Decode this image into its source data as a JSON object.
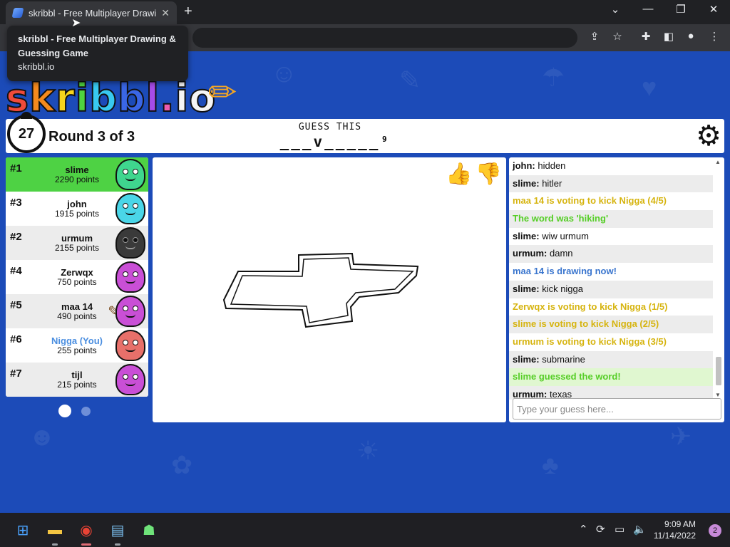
{
  "browser": {
    "tab_title": "skribbl - Free Multiplayer Drawing",
    "tab_close": "✕",
    "new_tab": "+",
    "tooltip_title": "skribbl - Free Multiplayer Drawing & Guessing Game",
    "tooltip_url": "skribbl.io"
  },
  "game": {
    "logo": "skribbl.io",
    "timer": "27",
    "round": "Round 3 of 3",
    "guess_label": "GUESS THIS",
    "word_pattern": "___v_____",
    "word_length": "9"
  },
  "players": [
    {
      "rank": "#1",
      "name": "slime",
      "points": "2290 points",
      "color": "#3fd68e",
      "style": "first"
    },
    {
      "rank": "#3",
      "name": "john",
      "points": "1915 points",
      "color": "#4ad6e8",
      "style": "normal"
    },
    {
      "rank": "#2",
      "name": "urmum",
      "points": "2155 points",
      "color": "#3a3a3a",
      "style": "alt"
    },
    {
      "rank": "#4",
      "name": "Zerwqx",
      "points": "750 points",
      "color": "#c94fd6",
      "style": "normal"
    },
    {
      "rank": "#5",
      "name": "maa 14",
      "points": "490 points",
      "color": "#c94fd6",
      "style": "alt"
    },
    {
      "rank": "#6",
      "name": "Nigga (You)",
      "points": "255 points",
      "color": "#e8706a",
      "style": "normal"
    },
    {
      "rank": "#7",
      "name": "tijl",
      "points": "215 points",
      "color": "#c94fd6",
      "style": "alt"
    }
  ],
  "chat": {
    "messages": [
      {
        "user": "john:",
        "text": " hidden",
        "type": "normal"
      },
      {
        "user": "slime:",
        "text": " hitler",
        "type": "alt"
      },
      {
        "user": "",
        "text": "maa 14 is voting to kick Nigga (4/5)",
        "type": "yellow"
      },
      {
        "user": "",
        "text": "The word was 'hiking'",
        "type": "green-alt"
      },
      {
        "user": "slime:",
        "text": " wiw urmum",
        "type": "normal"
      },
      {
        "user": "urmum:",
        "text": " damn",
        "type": "alt"
      },
      {
        "user": "",
        "text": "maa 14 is drawing now!",
        "type": "blue"
      },
      {
        "user": "slime:",
        "text": " kick nigga",
        "type": "alt"
      },
      {
        "user": "",
        "text": "Zerwqx is voting to kick Nigga (1/5)",
        "type": "yellow"
      },
      {
        "user": "",
        "text": "slime is voting to kick Nigga (2/5)",
        "type": "yellow-alt"
      },
      {
        "user": "",
        "text": "urmum is voting to kick Nigga (3/5)",
        "type": "yellow"
      },
      {
        "user": "slime:",
        "text": " submarine",
        "type": "alt"
      },
      {
        "user": "",
        "text": "slime guessed the word!",
        "type": "guessed"
      },
      {
        "user": "urmum:",
        "text": " texas",
        "type": "alt"
      }
    ],
    "placeholder": "Type your guess here..."
  },
  "taskbar": {
    "time": "9:09 AM",
    "date": "11/14/2022",
    "notifications": "2"
  },
  "colors": {
    "page_bg": "#1c4bb8",
    "first_place": "#4ed244",
    "chat_yellow": "#d6b40f",
    "chat_green": "#56ce27",
    "chat_blue": "#3975ce"
  }
}
